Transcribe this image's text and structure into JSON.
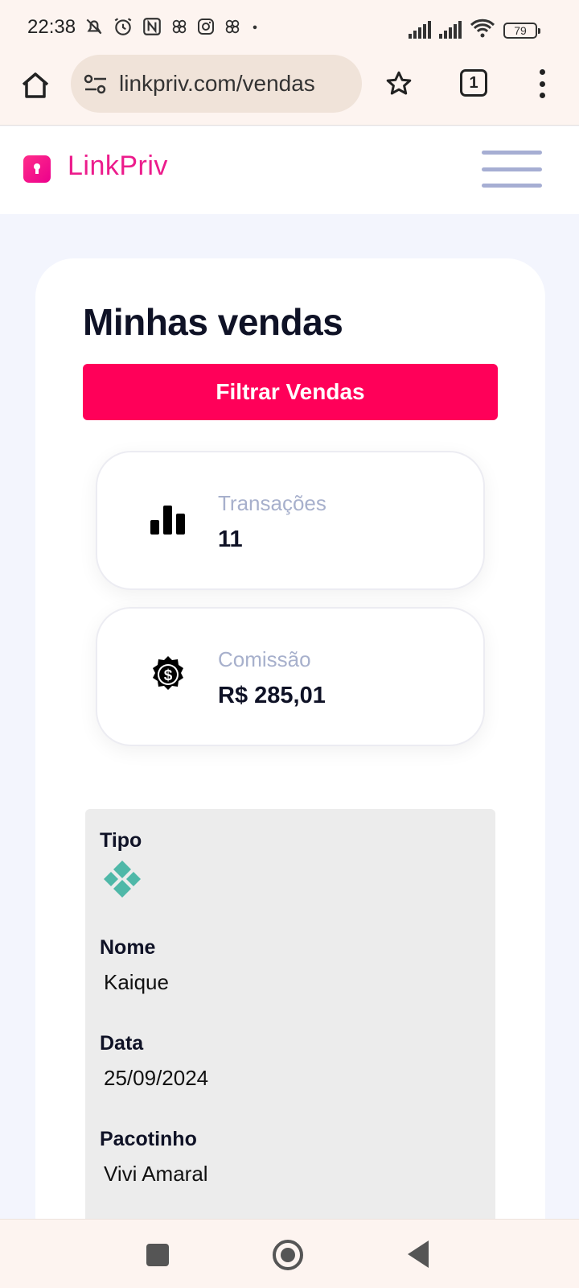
{
  "status_bar": {
    "time": "22:38",
    "battery": "79",
    "icons": [
      "bell-off-icon",
      "alarm-icon",
      "nfc-icon",
      "app-icon",
      "instagram-icon",
      "app-icon",
      "dot-icon",
      "signal-icon",
      "signal-icon",
      "wifi-icon",
      "battery-icon"
    ]
  },
  "browser": {
    "url": "linkpriv.com/vendas",
    "tab_count": "1"
  },
  "site": {
    "brand": "LinkPriv",
    "accent_color": "#ff0059",
    "brand_color": "#ec1c8c"
  },
  "page": {
    "title": "Minhas vendas",
    "filter_button": "Filtrar Vendas"
  },
  "stats": {
    "transactions": {
      "label": "Transações",
      "value": "11",
      "icon": "bar-chart-icon"
    },
    "commission": {
      "label": "Comissão",
      "value": "R$ 285,01",
      "icon": "dollar-badge-icon"
    }
  },
  "sale": {
    "tipo_label": "Tipo",
    "tipo_icon": "pix-icon",
    "nome_label": "Nome",
    "nome_value": "Kaique",
    "data_label": "Data",
    "data_value": "25/09/2024",
    "pacotinho_label": "Pacotinho",
    "pacotinho_value": "Vivi Amaral"
  },
  "nav": [
    "recents-button",
    "home-button",
    "back-button"
  ]
}
